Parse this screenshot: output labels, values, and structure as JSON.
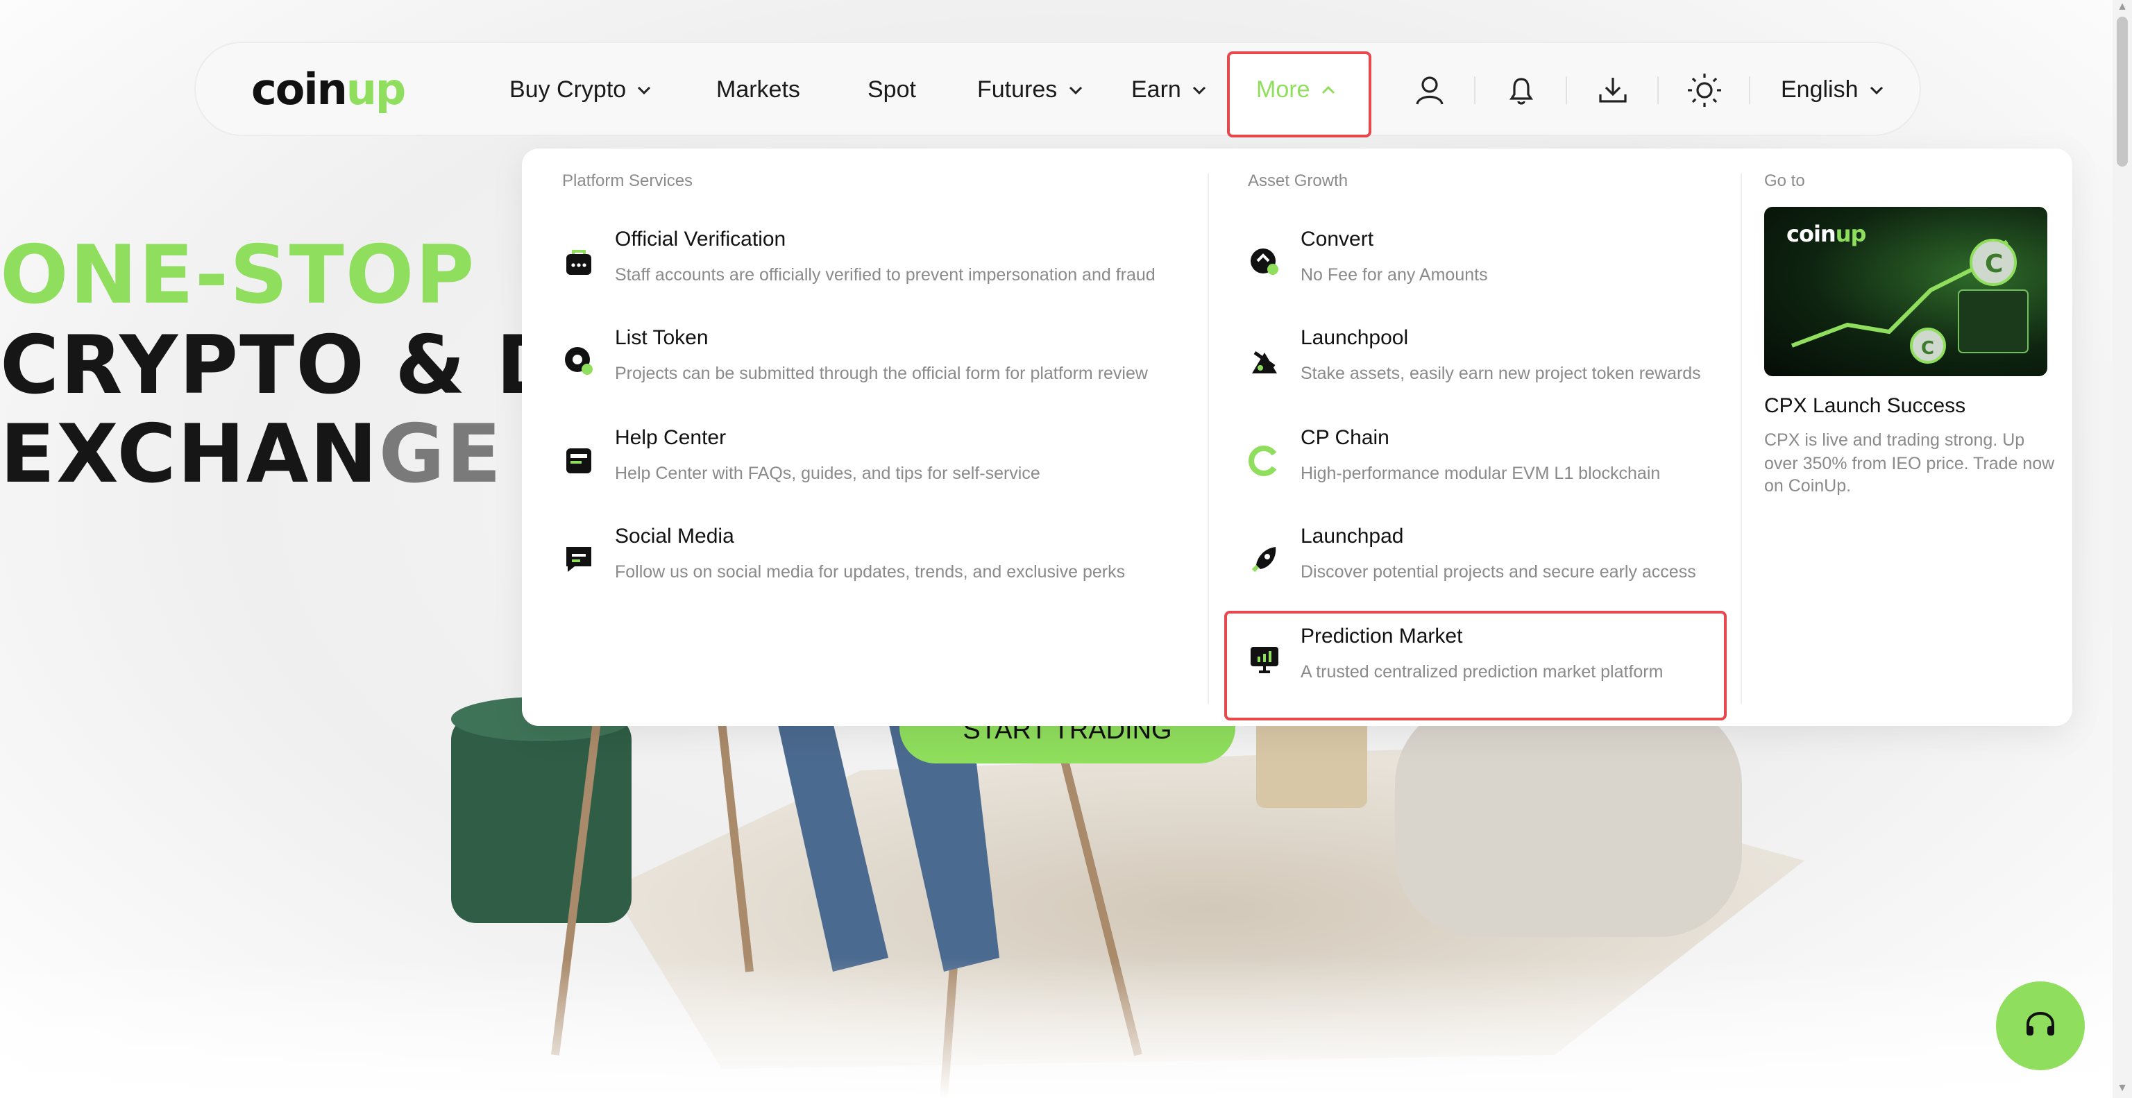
{
  "brand": {
    "name_main": "coin",
    "name_accent": "up",
    "accent_color": "#8fde5d"
  },
  "nav": {
    "items": [
      {
        "label": "Buy Crypto",
        "dropdown": true
      },
      {
        "label": "Markets",
        "dropdown": false
      },
      {
        "label": "Spot",
        "dropdown": false
      },
      {
        "label": "Futures",
        "dropdown": true
      },
      {
        "label": "Earn",
        "dropdown": true
      },
      {
        "label": "More",
        "dropdown": true,
        "active": true
      }
    ],
    "icons": [
      "user-icon",
      "bell-icon",
      "download-icon",
      "sun-icon"
    ],
    "language": "English"
  },
  "hero": {
    "line1": "ONE-STOP",
    "line2": "CRYPTO & D",
    "line3_dark": "EXCHAN",
    "line3_fade": "GE",
    "cta": "START TRADING"
  },
  "dropdown": {
    "platform": {
      "title": "Platform Services",
      "items": [
        {
          "title": "Official Verification",
          "desc": "Staff accounts are officially verified to prevent impersonation and fraud",
          "icon": "verification-icon"
        },
        {
          "title": "List Token",
          "desc": "Projects can be submitted through the official form for platform review",
          "icon": "list-token-icon"
        },
        {
          "title": "Help Center",
          "desc": "Help Center with FAQs, guides, and tips for self-service",
          "icon": "help-center-icon"
        },
        {
          "title": "Social Media",
          "desc": "Follow us on social media for updates, trends, and exclusive perks",
          "icon": "social-media-icon"
        }
      ]
    },
    "growth": {
      "title": "Asset Growth",
      "items": [
        {
          "title": "Convert",
          "desc": "No Fee for any Amounts",
          "icon": "convert-icon"
        },
        {
          "title": "Launchpool",
          "desc": "Stake assets, easily earn new project token rewards",
          "icon": "launchpool-icon"
        },
        {
          "title": "CP Chain",
          "desc": "High-performance modular EVM L1 blockchain",
          "icon": "cp-chain-icon"
        },
        {
          "title": "Launchpad",
          "desc": "Discover potential projects and secure early access",
          "icon": "launchpad-icon"
        },
        {
          "title": "Prediction Market",
          "desc": "A trusted centralized prediction market platform",
          "icon": "prediction-market-icon"
        }
      ]
    },
    "goto": {
      "title": "Go to",
      "promo_logo_main": "coin",
      "promo_logo_accent": "up",
      "promo_title": "CPX Launch Success",
      "promo_desc": "CPX is live and trading strong. Up over 350% from IEO price. Trade now on CoinUp."
    }
  }
}
